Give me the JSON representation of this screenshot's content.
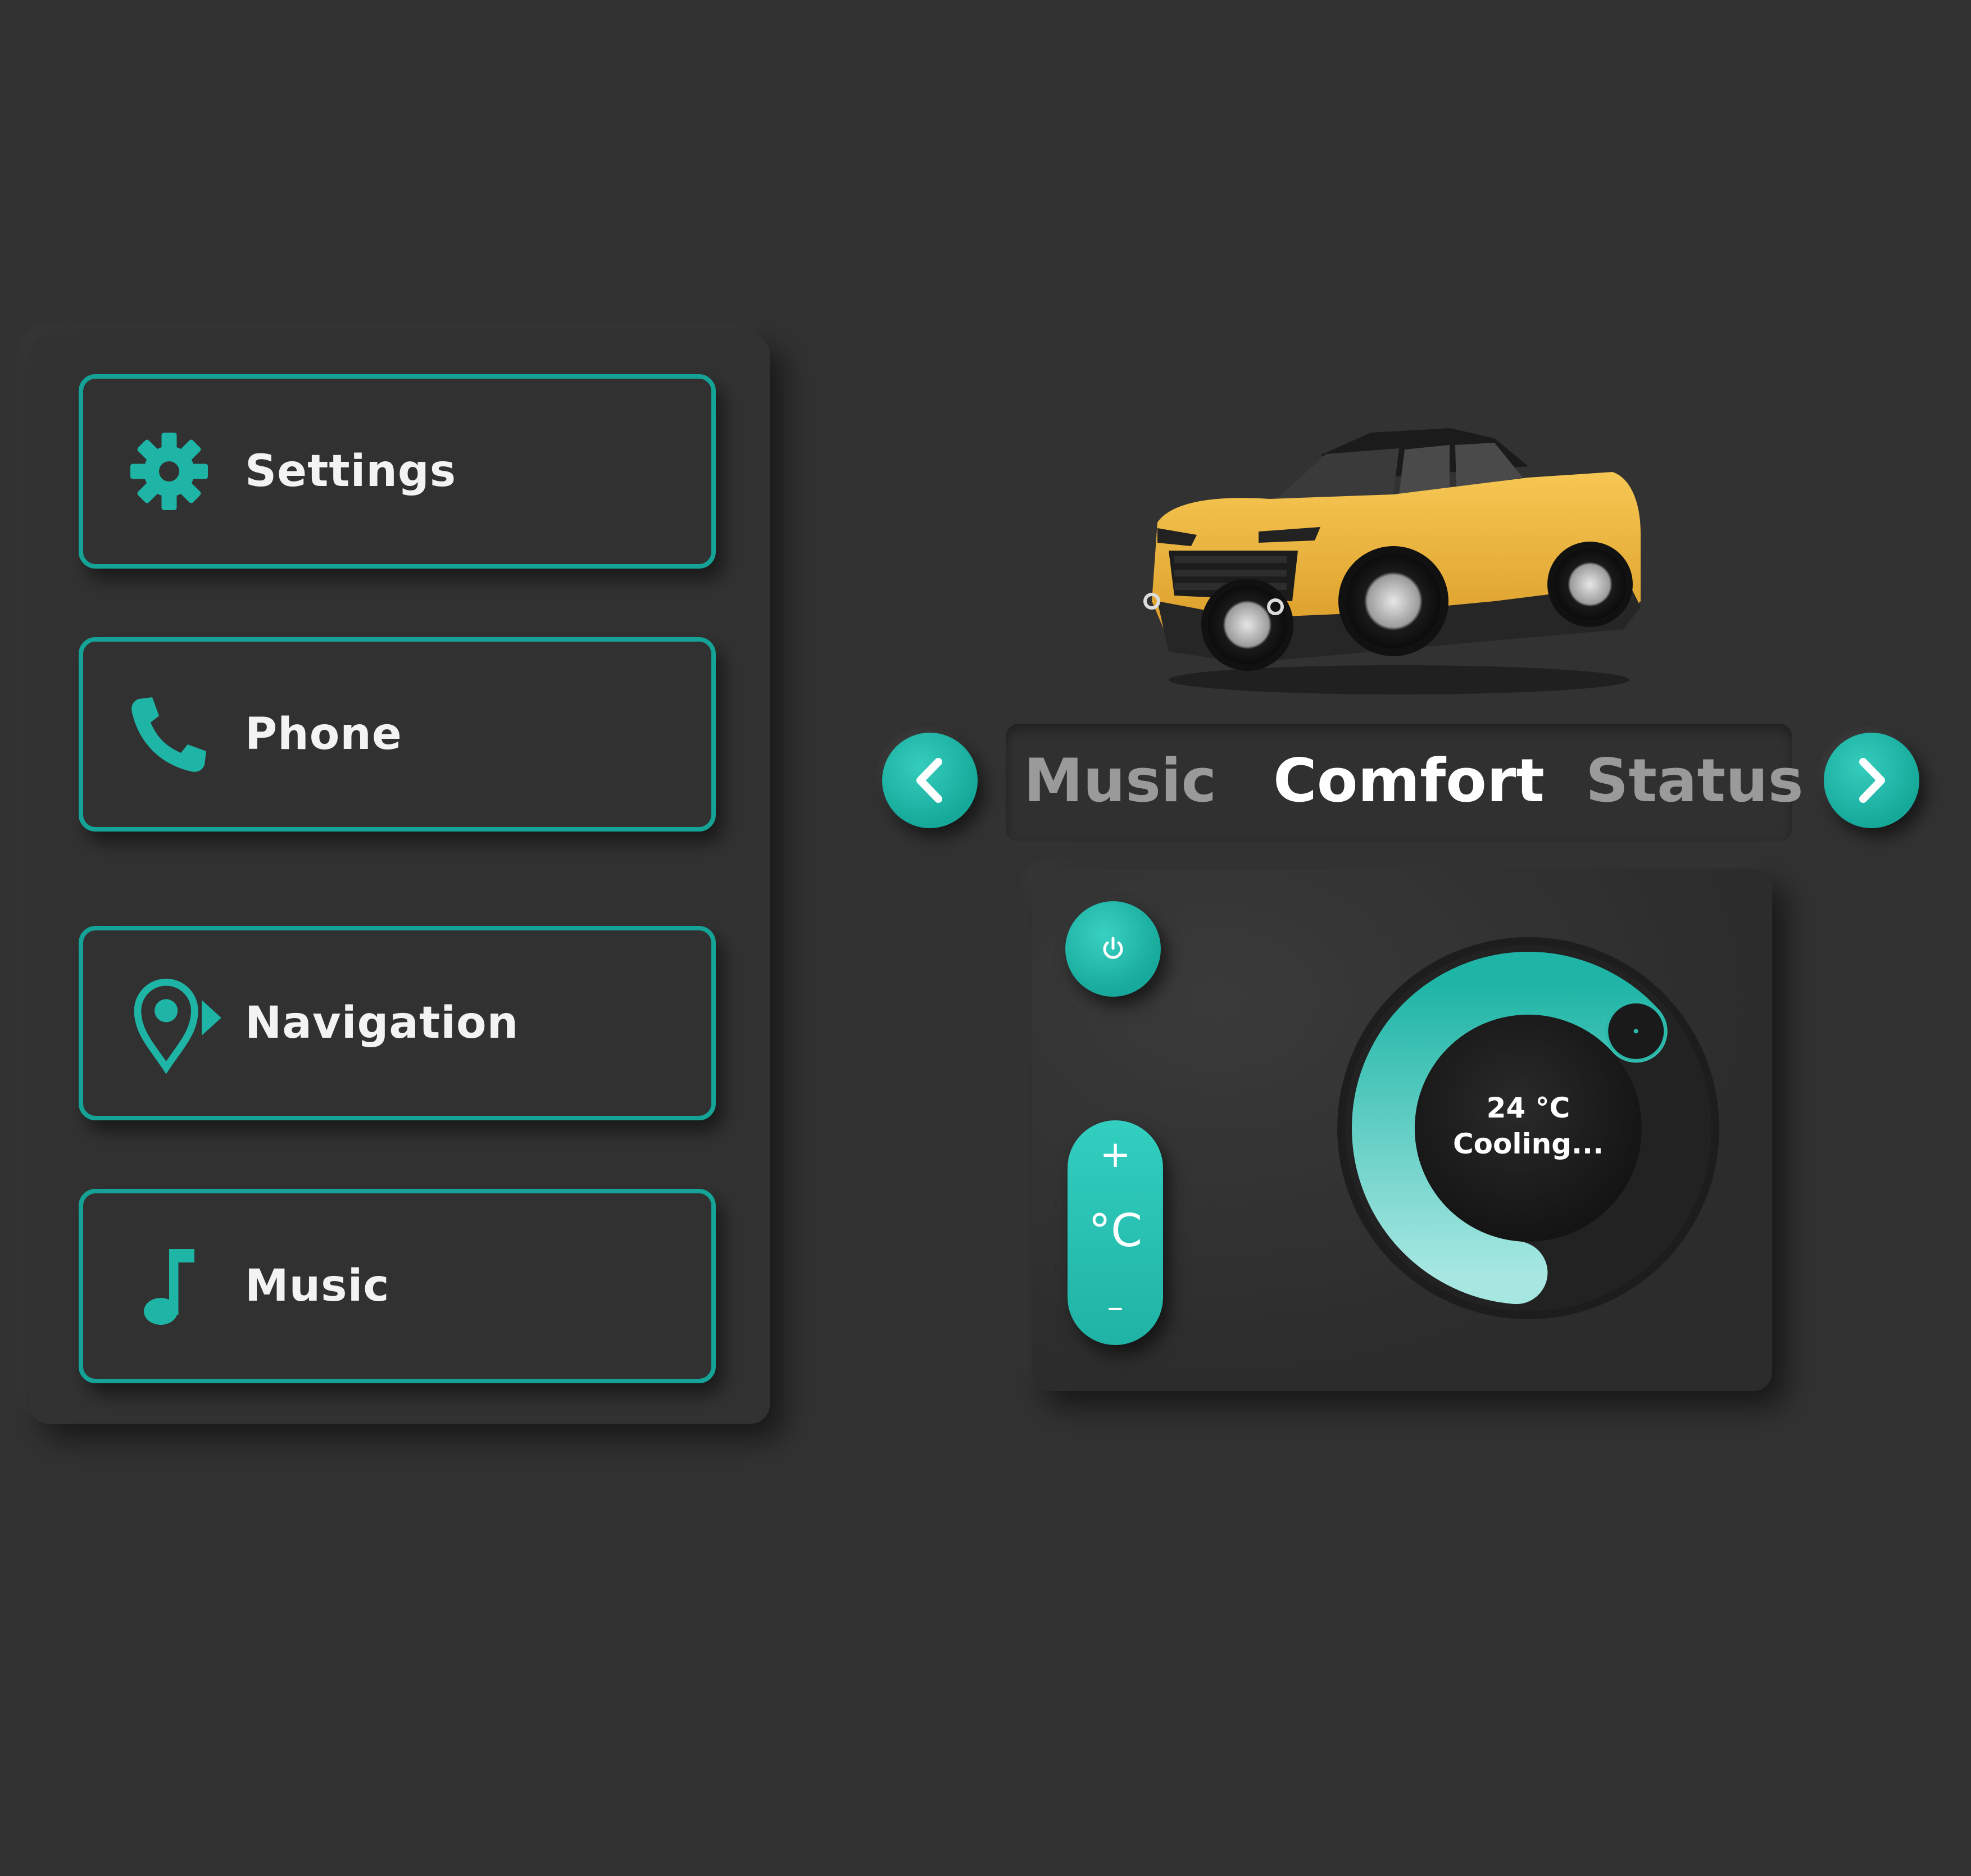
{
  "menu": {
    "items": [
      {
        "label": "Settings",
        "icon": "gear-icon"
      },
      {
        "label": "Phone",
        "icon": "phone-icon"
      },
      {
        "label": "Navigation",
        "icon": "location-pin-icon"
      },
      {
        "label": "Music",
        "icon": "music-note-icon"
      }
    ]
  },
  "car": {
    "image": "yellow-suv-photo"
  },
  "tabs": {
    "prev_icon": "chevron-left-icon",
    "next_icon": "chevron-right-icon",
    "items": [
      {
        "label": "Music",
        "active": false
      },
      {
        "label": "Comfort",
        "active": true
      },
      {
        "label": "Status",
        "active": false
      }
    ]
  },
  "climate": {
    "power_icon": "power-icon",
    "increase_label": "+",
    "unit_label": "°C",
    "decrease_label": "–",
    "temperature_value": "24",
    "temperature_unit": "°C",
    "temperature_display": "24 °C",
    "status": "Cooling...",
    "dial_fill_fraction": 0.62
  },
  "colors": {
    "background": "#323232",
    "accent": "#1eb5a6",
    "accent_light": "#a6e7e2",
    "text": "#f3f3f3",
    "tab_inactive": "#9a9a9a",
    "car_body": "#f0b23a"
  }
}
